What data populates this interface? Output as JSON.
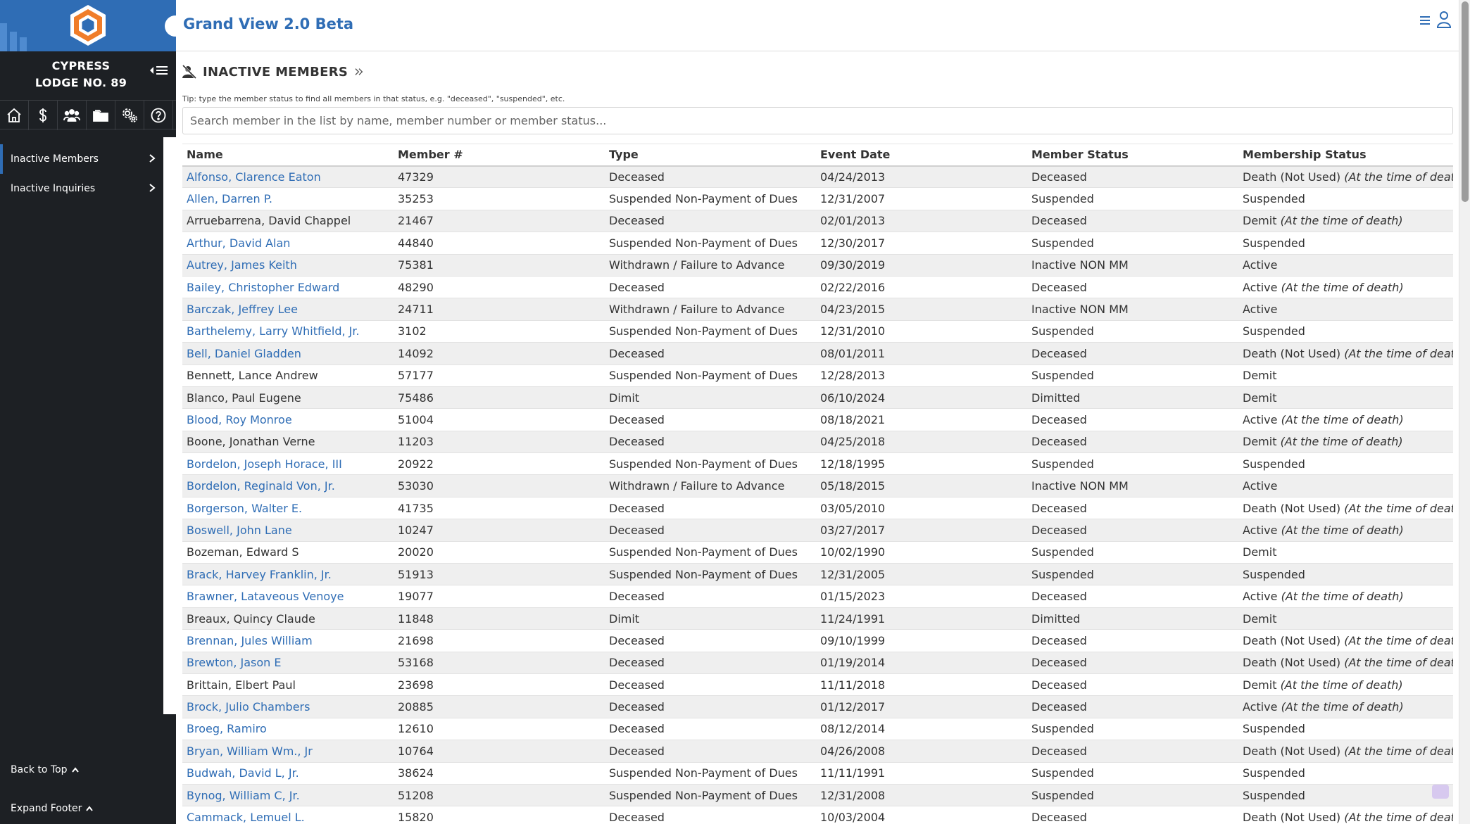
{
  "app": {
    "title": "Grand View 2.0 Beta"
  },
  "sidebar": {
    "lodge_line1": "CYPRESS",
    "lodge_line2": "LODGE NO. 89",
    "icons": [
      "home-icon",
      "dollar-icon",
      "members-icon",
      "folder-icon",
      "settings-icon",
      "help-icon"
    ],
    "items": [
      {
        "label": "Inactive Members",
        "active": true
      },
      {
        "label": "Inactive Inquiries",
        "active": false
      }
    ],
    "back_to_top": "Back to Top",
    "expand_footer": "Expand Footer"
  },
  "main": {
    "title": "INACTIVE MEMBERS",
    "tip": "Tip: type the member status to find all members in that status, e.g. \"deceased\", \"suspended\", etc.",
    "search_placeholder": "Search member in the list by name, member number or member status..."
  },
  "table": {
    "headers": [
      "Name",
      "Member #",
      "Type",
      "Event Date",
      "Member Status",
      "Membership Status"
    ],
    "rows": [
      {
        "name": "Alfonso, Clarence Eaton",
        "link": true,
        "num": "47329",
        "type": "Deceased",
        "date": "04/24/2013",
        "mstatus": "Deceased",
        "ship": "Death (Not Used)",
        "note": "(At the time of death)"
      },
      {
        "name": "Allen, Darren P.",
        "link": true,
        "num": "35253",
        "type": "Suspended Non-Payment of Dues",
        "date": "12/31/2007",
        "mstatus": "Suspended",
        "ship": "Suspended",
        "note": ""
      },
      {
        "name": "Arruebarrena, David Chappel",
        "link": false,
        "num": "21467",
        "type": "Deceased",
        "date": "02/01/2013",
        "mstatus": "Deceased",
        "ship": "Demit",
        "note": "(At the time of death)"
      },
      {
        "name": "Arthur, David Alan",
        "link": true,
        "num": "44840",
        "type": "Suspended Non-Payment of Dues",
        "date": "12/30/2017",
        "mstatus": "Suspended",
        "ship": "Suspended",
        "note": ""
      },
      {
        "name": "Autrey, James Keith",
        "link": true,
        "num": "75381",
        "type": "Withdrawn / Failure to Advance",
        "date": "09/30/2019",
        "mstatus": "Inactive NON MM",
        "ship": "Active",
        "note": ""
      },
      {
        "name": "Bailey, Christopher Edward",
        "link": true,
        "num": "48290",
        "type": "Deceased",
        "date": "02/22/2016",
        "mstatus": "Deceased",
        "ship": "Active",
        "note": "(At the time of death)"
      },
      {
        "name": "Barczak, Jeffrey Lee",
        "link": true,
        "num": "24711",
        "type": "Withdrawn / Failure to Advance",
        "date": "04/23/2015",
        "mstatus": "Inactive NON MM",
        "ship": "Active",
        "note": ""
      },
      {
        "name": "Barthelemy, Larry Whitfield, Jr.",
        "link": true,
        "num": "3102",
        "type": "Suspended Non-Payment of Dues",
        "date": "12/31/2010",
        "mstatus": "Suspended",
        "ship": "Suspended",
        "note": ""
      },
      {
        "name": "Bell, Daniel Gladden",
        "link": true,
        "num": "14092",
        "type": "Deceased",
        "date": "08/01/2011",
        "mstatus": "Deceased",
        "ship": "Death (Not Used)",
        "note": "(At the time of death)"
      },
      {
        "name": "Bennett, Lance Andrew",
        "link": false,
        "num": "57177",
        "type": "Suspended Non-Payment of Dues",
        "date": "12/28/2013",
        "mstatus": "Suspended",
        "ship": "Demit",
        "note": ""
      },
      {
        "name": "Blanco, Paul Eugene",
        "link": false,
        "num": "75486",
        "type": "Dimit",
        "date": "06/10/2024",
        "mstatus": "Dimitted",
        "ship": "Demit",
        "note": ""
      },
      {
        "name": "Blood, Roy Monroe",
        "link": true,
        "num": "51004",
        "type": "Deceased",
        "date": "08/18/2021",
        "mstatus": "Deceased",
        "ship": "Active",
        "note": "(At the time of death)"
      },
      {
        "name": "Boone, Jonathan Verne",
        "link": false,
        "num": "11203",
        "type": "Deceased",
        "date": "04/25/2018",
        "mstatus": "Deceased",
        "ship": "Demit",
        "note": "(At the time of death)"
      },
      {
        "name": "Bordelon, Joseph Horace, III",
        "link": true,
        "num": "20922",
        "type": "Suspended Non-Payment of Dues",
        "date": "12/18/1995",
        "mstatus": "Suspended",
        "ship": "Suspended",
        "note": ""
      },
      {
        "name": "Bordelon, Reginald Von, Jr.",
        "link": true,
        "num": "53030",
        "type": "Withdrawn / Failure to Advance",
        "date": "05/18/2015",
        "mstatus": "Inactive NON MM",
        "ship": "Active",
        "note": ""
      },
      {
        "name": "Borgerson, Walter E.",
        "link": true,
        "num": "41735",
        "type": "Deceased",
        "date": "03/05/2010",
        "mstatus": "Deceased",
        "ship": "Death (Not Used)",
        "note": "(At the time of death)"
      },
      {
        "name": "Boswell, John Lane",
        "link": true,
        "num": "10247",
        "type": "Deceased",
        "date": "03/27/2017",
        "mstatus": "Deceased",
        "ship": "Active",
        "note": "(At the time of death)"
      },
      {
        "name": "Bozeman, Edward S",
        "link": false,
        "num": "20020",
        "type": "Suspended Non-Payment of Dues",
        "date": "10/02/1990",
        "mstatus": "Suspended",
        "ship": "Demit",
        "note": ""
      },
      {
        "name": "Brack, Harvey Franklin, Jr.",
        "link": true,
        "num": "51913",
        "type": "Suspended Non-Payment of Dues",
        "date": "12/31/2005",
        "mstatus": "Suspended",
        "ship": "Suspended",
        "note": ""
      },
      {
        "name": "Brawner, Lataveous Venoye",
        "link": true,
        "num": "19077",
        "type": "Deceased",
        "date": "01/15/2023",
        "mstatus": "Deceased",
        "ship": "Active",
        "note": "(At the time of death)"
      },
      {
        "name": "Breaux, Quincy Claude",
        "link": false,
        "num": "11848",
        "type": "Dimit",
        "date": "11/24/1991",
        "mstatus": "Dimitted",
        "ship": "Demit",
        "note": ""
      },
      {
        "name": "Brennan, Jules William",
        "link": true,
        "num": "21698",
        "type": "Deceased",
        "date": "09/10/1999",
        "mstatus": "Deceased",
        "ship": "Death (Not Used)",
        "note": "(At the time of death)"
      },
      {
        "name": "Brewton, Jason E",
        "link": true,
        "num": "53168",
        "type": "Deceased",
        "date": "01/19/2014",
        "mstatus": "Deceased",
        "ship": "Death (Not Used)",
        "note": "(At the time of death)"
      },
      {
        "name": "Brittain, Elbert Paul",
        "link": false,
        "num": "23698",
        "type": "Deceased",
        "date": "11/11/2018",
        "mstatus": "Deceased",
        "ship": "Demit",
        "note": "(At the time of death)"
      },
      {
        "name": "Brock, Julio Chambers",
        "link": true,
        "num": "20885",
        "type": "Deceased",
        "date": "01/12/2017",
        "mstatus": "Deceased",
        "ship": "Active",
        "note": "(At the time of death)"
      },
      {
        "name": "Broeg, Ramiro",
        "link": true,
        "num": "12610",
        "type": "Deceased",
        "date": "08/12/2014",
        "mstatus": "Suspended",
        "ship": "Suspended",
        "note": ""
      },
      {
        "name": "Bryan, William Wm., Jr",
        "link": true,
        "num": "10764",
        "type": "Deceased",
        "date": "04/26/2008",
        "mstatus": "Deceased",
        "ship": "Death (Not Used)",
        "note": "(At the time of death)"
      },
      {
        "name": "Budwah, David L, Jr.",
        "link": true,
        "num": "38624",
        "type": "Suspended Non-Payment of Dues",
        "date": "11/11/1991",
        "mstatus": "Suspended",
        "ship": "Suspended",
        "note": ""
      },
      {
        "name": "Bynog, William C, Jr.",
        "link": true,
        "num": "51208",
        "type": "Suspended Non-Payment of Dues",
        "date": "12/31/2008",
        "mstatus": "Suspended",
        "ship": "Suspended",
        "note": ""
      },
      {
        "name": "Cammack, Lemuel L.",
        "link": true,
        "num": "15820",
        "type": "Deceased",
        "date": "10/03/2004",
        "mstatus": "Deceased",
        "ship": "Death (Not Used)",
        "note": "(At the time of death)"
      }
    ]
  },
  "colors": {
    "brand": "#2f6db5",
    "sidebar": "#1d2024",
    "row_alt": "#efefef",
    "logo_orange": "#f07d2a"
  }
}
